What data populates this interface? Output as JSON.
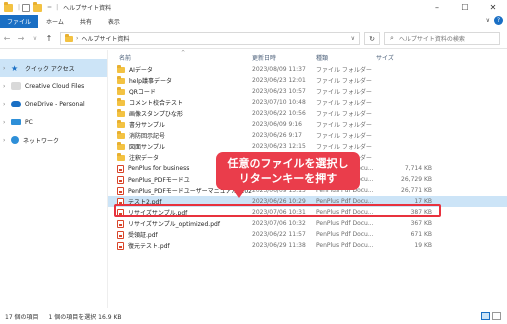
{
  "window": {
    "title": "ヘルプサイト資料",
    "controls": {
      "minimize": "–",
      "maximize": "☐",
      "close": "✕"
    }
  },
  "ribbon": {
    "tabs": [
      "ファイル",
      "ホーム",
      "共有",
      "表示"
    ],
    "collapse": "∨",
    "help": "?"
  },
  "address": {
    "back": "←",
    "forward": "→",
    "recent": "∨",
    "up": "↑",
    "path_sep": "›",
    "path": "ヘルプサイト資料",
    "dropdown": "∨",
    "refresh": "↻",
    "search_icon": "⌕",
    "search_placeholder": "ヘルプサイト資料の検索"
  },
  "sidebar": {
    "items": [
      {
        "label": "クイック アクセス",
        "icon": "star-icon",
        "selected": true
      },
      {
        "label": "Creative Cloud Files",
        "icon": "creative-cloud-icon"
      },
      {
        "label": "OneDrive - Personal",
        "icon": "cloud-icon"
      },
      {
        "label": "PC",
        "icon": "pc-icon"
      },
      {
        "label": "ネットワーク",
        "icon": "network-icon"
      }
    ]
  },
  "columns": {
    "sort_caret": "^",
    "name": "名前",
    "date": "更新日時",
    "type": "種類",
    "size": "サイズ"
  },
  "files": [
    {
      "name": "AIデータ",
      "date": "2023/08/09 11:37",
      "type": "ファイル フォルダー",
      "size": "",
      "kind": "folder"
    },
    {
      "name": "help議事データ",
      "date": "2023/06/23 12:01",
      "type": "ファイル フォルダー",
      "size": "",
      "kind": "folder"
    },
    {
      "name": "QRコード",
      "date": "2023/06/23 10:57",
      "type": "ファイル フォルダー",
      "size": "",
      "kind": "folder"
    },
    {
      "name": "コメント校合テスト",
      "date": "2023/07/10 10:48",
      "type": "ファイル フォルダー",
      "size": "",
      "kind": "folder"
    },
    {
      "name": "画像スタンプひな形",
      "date": "2023/06/22 10:56",
      "type": "ファイル フォルダー",
      "size": "",
      "kind": "folder"
    },
    {
      "name": "書分サンプル",
      "date": "2023/06/09 9:16",
      "type": "ファイル フォルダー",
      "size": "",
      "kind": "folder"
    },
    {
      "name": "消防回示記号",
      "date": "2023/06/26 9:17",
      "type": "ファイル フォルダー",
      "size": "",
      "kind": "folder"
    },
    {
      "name": "図面サンプル",
      "date": "2023/06/23 12:15",
      "type": "ファイル フォルダー",
      "size": "",
      "kind": "folder"
    },
    {
      "name": "注釈データ",
      "date": "2023/06/21 13:15",
      "type": "ファイル フォルダー",
      "size": "",
      "kind": "folder"
    },
    {
      "name": "PenPlus for business",
      "date": "2023/06/16 10:27",
      "type": "PenPlus Pdf Docu...",
      "size": "7,714 KB",
      "kind": "pdf"
    },
    {
      "name": "PenPlus_PDFモードユ",
      "date": "2023/06/09 9:21",
      "type": "PenPlus Pdf Docu...",
      "size": "26,729 KB",
      "kind": "pdf"
    },
    {
      "name": "PenPlus_PDFモードユーザーマニュアル_20230S...",
      "date": "2023/06/09 13:15",
      "type": "PenPlus Pdf Docu...",
      "size": "26,771 KB",
      "kind": "pdf"
    },
    {
      "name": "テスト2.pdf",
      "date": "2023/06/26 10:29",
      "type": "PenPlus Pdf Docu...",
      "size": "17 KB",
      "kind": "pdf",
      "selected": true
    },
    {
      "name": "リサイズサンプル.pdf",
      "date": "2023/07/06 10:31",
      "type": "PenPlus Pdf Docu...",
      "size": "387 KB",
      "kind": "pdf"
    },
    {
      "name": "リサイズサンプル_optimized.pdf",
      "date": "2023/07/06 10:32",
      "type": "PenPlus Pdf Docu...",
      "size": "367 KB",
      "kind": "pdf"
    },
    {
      "name": "受領証.pdf",
      "date": "2023/06/22 11:57",
      "type": "PenPlus Pdf Docu...",
      "size": "671 KB",
      "kind": "pdf"
    },
    {
      "name": "復元テスト.pdf",
      "date": "2023/06/29 11:38",
      "type": "PenPlus Pdf Docu...",
      "size": "19 KB",
      "kind": "pdf"
    }
  ],
  "callout": {
    "line1": "任意のファイルを選択し",
    "line2": "リターンキーを押す"
  },
  "status": {
    "count": "17 個の項目",
    "selection": "1 個の項目を選択 16.9 KB"
  },
  "colors": {
    "accent": "#1a6fc4",
    "selection": "#cce4f7",
    "callout": "#ea3d4b",
    "folder": "#f3c242"
  }
}
